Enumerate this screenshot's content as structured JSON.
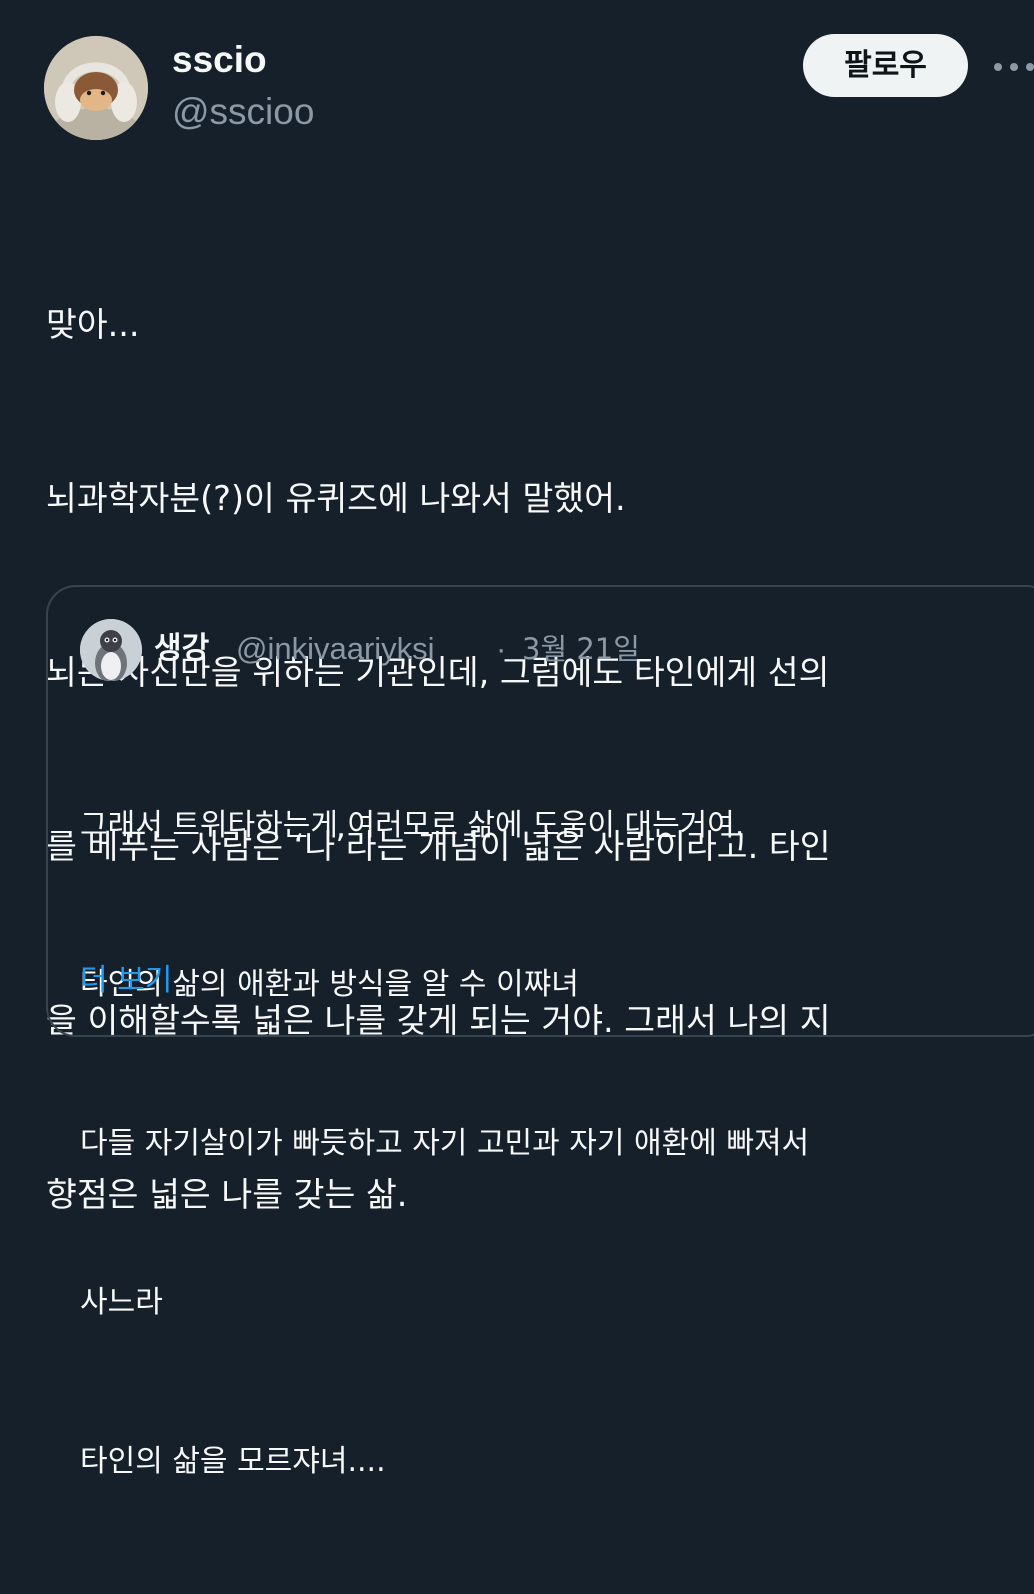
{
  "author": {
    "display_name": "sscio",
    "handle": "@sscioo",
    "avatar_icon": "monkey-with-headphones-avatar"
  },
  "header": {
    "follow_label": "팔로우",
    "more_icon": "more-options-icon"
  },
  "tweet": {
    "lines": [
      "맞아...",
      "뇌과학자분(?)이 유퀴즈에 나와서 말했어.",
      "뇌는 자신만을 위하는 기관인데, 그럼에도 타인에게 선의",
      "를 베푸는 사람은 ‘나’라는 개념이 넓은 사람이라고. 타인",
      "을 이해할수록 넓은 나를 갖게 되는 거야. 그래서 나의 지",
      "향점은 넓은 나를 갖는 삶."
    ]
  },
  "quote": {
    "display_name": "생강",
    "handle": "@inkivaariyksi",
    "separator": "·",
    "date": "3월 21일",
    "avatar_icon": "penguin-avatar",
    "lines": [
      "그래서 트위타하는게 여러모로 삶에 도움이 대는거여.",
      "타인의 삶의 애환과 방식을 알 수 이쨔녀",
      "다들 자기살이가 빠듯하고 자기 고민과 자기 애환에 빠져서",
      "사느라",
      "타인의 삶을 모르쟈녀...."
    ],
    "show_more_label": "더 보기"
  },
  "colors": {
    "background": "#15202b",
    "text_primary": "#f7f9f9",
    "text_secondary": "#8b98a5",
    "border": "#38444d",
    "link": "#1d9bf0",
    "follow_button_bg": "#eff3f4"
  }
}
